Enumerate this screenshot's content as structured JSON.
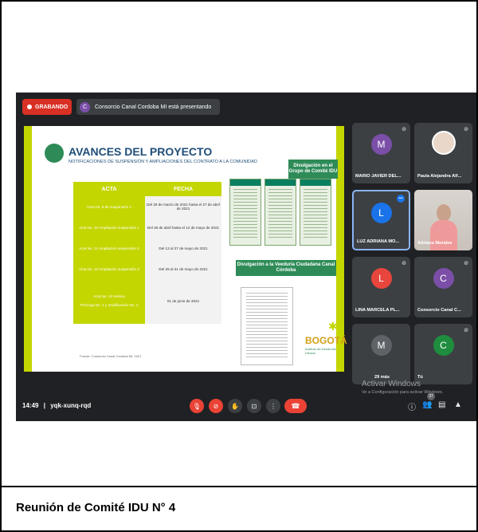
{
  "meeting": {
    "recording_label": "GRABANDO",
    "presenting_avatar": "C",
    "presenting_text": "Consorcio Canal Cordoba MI está presentando",
    "time": "14:49",
    "separator": "|",
    "code": "yqk-xunq-rqd",
    "activate_title": "Activar Windows",
    "activate_sub": "Ve a Configuración para activar Windows.",
    "chat_badge": "37"
  },
  "slide": {
    "title": "AVANCES DEL PROYECTO",
    "subtitle": "NOTIFICACIONES DE SUSPENSIÓN Y AMPLIACIONES DEL CONTRATO A LA COMUNIDAD",
    "table": {
      "headers": [
        "ACTA",
        "FECHA"
      ],
      "rows": [
        [
          "Acta No. 8 de suspensión 1",
          "Del 29 de marzo de 2021 hasta el 27 de abril de 2021"
        ],
        [
          "Acta No. 10 Ampliación suspensión 1",
          "Del 28 de abril hasta el 12 de mayo de 2021"
        ],
        [
          "Acta No. 11 Ampliación suspensión 2",
          "Del 13 al 27 de mayo de 2021"
        ],
        [
          "Acta No. 12 Ampliación suspensión 3",
          "Del 28 al 31 de mayo de 2021"
        ]
      ],
      "last_acta_a": "Acta No. 13 reinicio",
      "last_acta_b": "Prórroga No. 1 y modificación No. 4",
      "last_fecha": "01 de junio de 2021"
    },
    "box1": "Divulgación en el Grupo de Comité IDU",
    "box2": "Divulgación a la Veeduría Ciudadana Canal Córdoba",
    "logo": "BOGOTÁ",
    "logo_sub": "Instituto de Desarrollo Urbano",
    "source": "Fuente: Consorcio Canal Córdoba MI, 2021"
  },
  "participants": [
    {
      "initial": "M",
      "name": "MARIO JAVIER DEL...",
      "color": "#7b4fa8"
    },
    {
      "initial": "",
      "name": "Paula Alejandra Alf...",
      "color": "#3c4043"
    },
    {
      "initial": "L",
      "name": "LUZ ADRIANA MO...",
      "color": "#1a73e8"
    },
    {
      "initial": "",
      "name": "Adriana Morales",
      "color": "#3c4043"
    },
    {
      "initial": "L",
      "name": "LINA MARCELA PL...",
      "color": "#e8453c"
    },
    {
      "initial": "C",
      "name": "Consorcio Canal C...",
      "color": "#7b4fa8"
    },
    {
      "initial": "M",
      "name": "29 más",
      "color": "#5f6368"
    },
    {
      "initial": "C",
      "name": "Tú",
      "color": "#1e8e3e"
    }
  ],
  "caption": "Reunión de Comité IDU N° 4",
  "icons": [
    "mic-off-icon",
    "camera-off-icon",
    "hand-icon",
    "present-icon",
    "more-icon",
    "hangup-icon",
    "info-icon",
    "people-icon",
    "chat-icon",
    "activities-icon"
  ]
}
